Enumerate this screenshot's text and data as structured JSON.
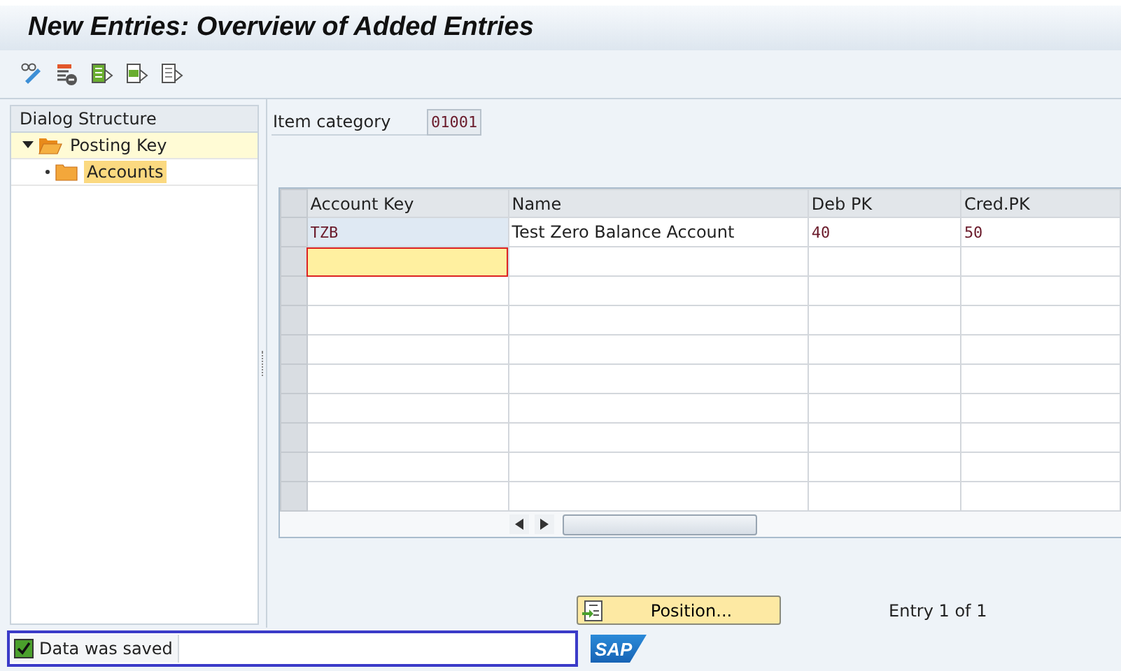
{
  "window": {
    "title": "New Entries: Overview of Added Entries"
  },
  "dialog_structure": {
    "title": "Dialog Structure",
    "items": [
      {
        "label": "Posting Key",
        "expanded": true,
        "selected": false,
        "children": [
          {
            "label": "Accounts",
            "selected": true
          }
        ]
      }
    ]
  },
  "item_category": {
    "label": "Item category",
    "value": "01001"
  },
  "table": {
    "columns": [
      "Account Key",
      "Name",
      "Deb PK",
      "Cred.PK"
    ],
    "rows": [
      {
        "account_key": "TZB",
        "name": "Test Zero Balance Account",
        "deb_pk": "40",
        "cred_pk": "50",
        "focused": false
      },
      {
        "focused": true
      }
    ]
  },
  "position_button": {
    "label": "Position..."
  },
  "entry_counter": "Entry 1 of 1",
  "status_bar": {
    "kind": "success",
    "message": "Data was saved"
  },
  "logo": "SAP"
}
